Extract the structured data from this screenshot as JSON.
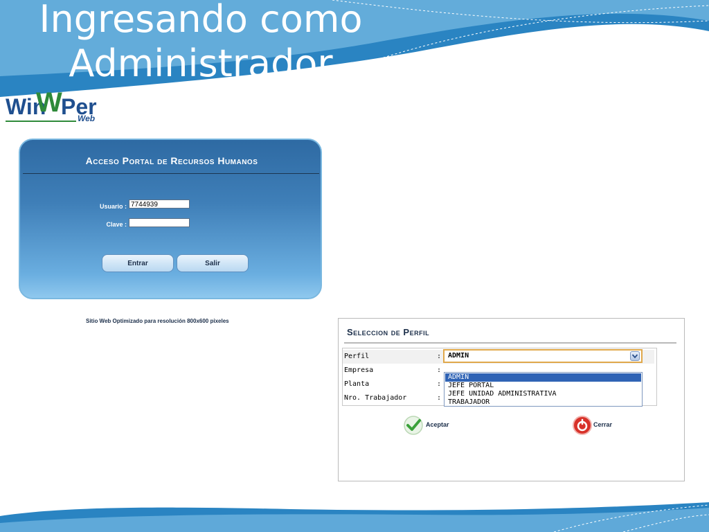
{
  "slide": {
    "title_line1": "Ingresando como",
    "title_line2": "Administrador"
  },
  "logo": {
    "win": "Win",
    "w": "W",
    "per": "Per",
    "web": "Web"
  },
  "login": {
    "title": "Acceso Portal de Recursos Humanos",
    "usuario_label": "Usuario :",
    "usuario_value": "7744939",
    "clave_label": "Clave :",
    "clave_value": "",
    "enter_button": "Entrar",
    "exit_button": "Salir",
    "footer_note": "Sitio Web Optimizado para resolución 800x600 pixeles"
  },
  "profile": {
    "title": "Seleccion de Perfil",
    "fields": [
      {
        "label": "Perfil",
        "colon": ":"
      },
      {
        "label": "Empresa",
        "colon": ":"
      },
      {
        "label": "Planta",
        "colon": ":"
      },
      {
        "label": "Nro. Trabajador",
        "colon": ":"
      }
    ],
    "selected_value": "ADMIN",
    "options": [
      "ADMIN",
      "JEFE PORTAL",
      "JEFE UNIDAD ADMINISTRATIVA",
      "TRABAJADOR"
    ],
    "accept_label": "Aceptar",
    "close_label": "Cerrar"
  },
  "colors": {
    "accent_blue": "#2f63b5",
    "panel_blue": "#3f7fb8",
    "accept_green": "#3aa13a",
    "close_red": "#d8322a"
  }
}
